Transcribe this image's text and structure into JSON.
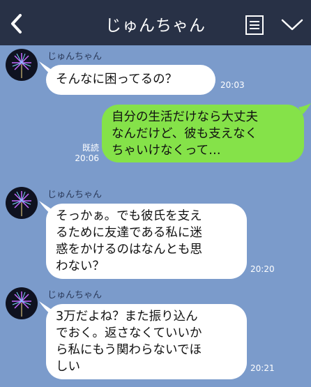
{
  "header": {
    "title": "じゅんちゃん"
  },
  "messages": [
    {
      "sender": "じゅんちゃん",
      "lines": [
        "そんなに困ってるの？"
      ],
      "time": "20:03"
    },
    {
      "lines": [
        "自分の生活だけなら大丈夫",
        "なんだけど、彼も支えなく",
        "ちゃいけなくって…"
      ],
      "read_label": "既読",
      "time": "20:06"
    },
    {
      "sender": "じゅんちゃん",
      "lines": [
        "そっかぁ。でも彼氏を支え",
        "るために友達である私に迷",
        "惑をかけるのはなんとも思",
        "わない？"
      ],
      "time": "20:20"
    },
    {
      "sender": "じゅんちゃん",
      "lines": [
        "3万だよね？また振り込ん",
        "でおく。返さなくていいか",
        "ら私にもう関わらないでほ",
        "しい"
      ],
      "time": "20:21"
    }
  ],
  "colors": {
    "header_bg": "#283146",
    "chat_bg": "#7b9bcb",
    "incoming_bubble": "#ffffff",
    "outgoing_bubble": "#85e249"
  },
  "icons": [
    "back-icon",
    "menu-icon",
    "chevron-down-icon",
    "firework-avatar-icon"
  ]
}
